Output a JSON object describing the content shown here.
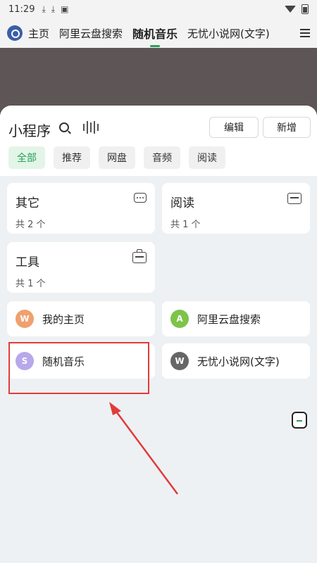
{
  "status_bar": {
    "time": "11:29",
    "icons": [
      "download-icon",
      "download-icon",
      "app-icon"
    ]
  },
  "top_nav": {
    "items": [
      "主页",
      "阿里云盘搜索",
      "随机音乐",
      "无忧小说网(文字)"
    ],
    "active_index": 2
  },
  "sheet": {
    "title": "小程序",
    "edit_label": "编辑",
    "add_label": "新增",
    "tabs": [
      "全部",
      "推荐",
      "网盘",
      "音频",
      "阅读"
    ],
    "active_tab": "全部",
    "categories": [
      {
        "name": "其它",
        "count": "共 2 个",
        "icon": "more-icon"
      },
      {
        "name": "阅读",
        "count": "共 1 个",
        "icon": "book-icon"
      },
      {
        "name": "工具",
        "count": "共 1 个",
        "icon": "toolbox-icon"
      }
    ],
    "apps": [
      {
        "name": "我的主页",
        "avatar_letter": "W",
        "color": "#f0a06e"
      },
      {
        "name": "阿里云盘搜索",
        "avatar_letter": "A",
        "color": "#7cc44a"
      },
      {
        "name": "随机音乐",
        "avatar_letter": "S",
        "color": "#b9a7ec"
      },
      {
        "name": "无忧小说网(文字)",
        "avatar_letter": "W",
        "color": "#666666"
      }
    ]
  },
  "annotation": {
    "highlight_color": "#e23b3b",
    "highlighted_app": "随机音乐"
  },
  "colors": {
    "accent": "#24a05a",
    "backdrop": "#5e5557",
    "sheet_bg": "#eef1f4"
  }
}
